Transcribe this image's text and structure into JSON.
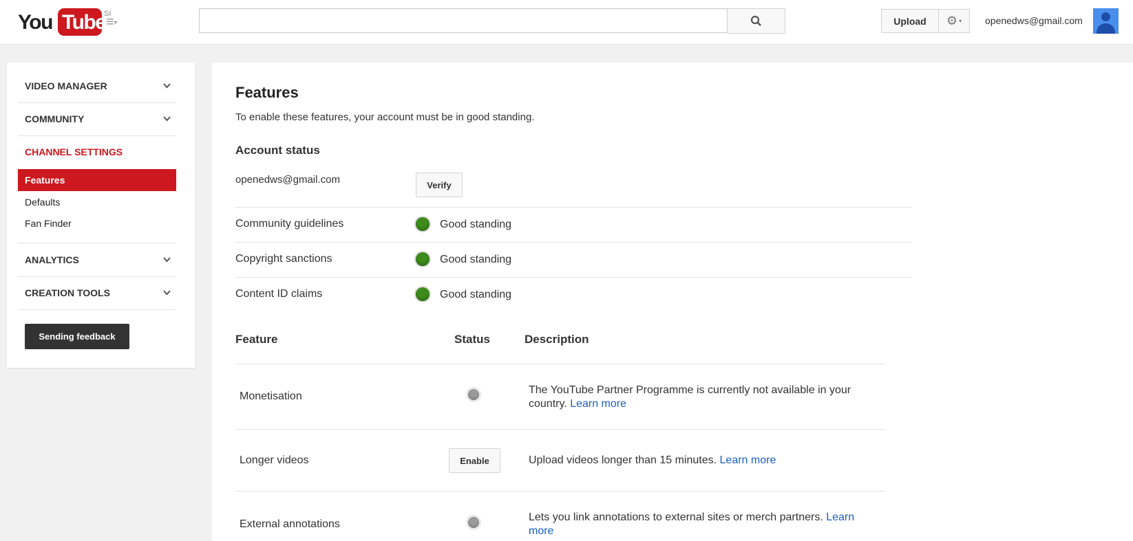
{
  "header": {
    "logo_you": "You",
    "logo_tube": "Tube",
    "country_code": "SI",
    "search_placeholder": "",
    "upload_label": "Upload",
    "account_email": "openedws@gmail.com"
  },
  "sidebar": {
    "sections": [
      {
        "label": "VIDEO MANAGER"
      },
      {
        "label": "COMMUNITY"
      },
      {
        "label": "CHANNEL SETTINGS"
      },
      {
        "label": "ANALYTICS"
      },
      {
        "label": "CREATION TOOLS"
      }
    ],
    "channel_items": [
      {
        "label": "Features",
        "active": true
      },
      {
        "label": "Defaults",
        "active": false
      },
      {
        "label": "Fan Finder",
        "active": false
      }
    ],
    "feedback_label": "Sending feedback"
  },
  "main": {
    "title": "Features",
    "subtitle": "To enable these features, your account must be in good standing.",
    "account_status_heading": "Account status",
    "account_email": "openedws@gmail.com",
    "verify_label": "Verify",
    "statuses": [
      {
        "label": "Community guidelines",
        "value": "Good standing"
      },
      {
        "label": "Copyright sanctions",
        "value": "Good standing"
      },
      {
        "label": "Content ID claims",
        "value": "Good standing"
      }
    ],
    "table_headers": {
      "feature": "Feature",
      "status": "Status",
      "description": "Description"
    },
    "features": [
      {
        "name": "Monetisation",
        "status": "unavailable",
        "description": "The YouTube Partner Programme is currently not available in your country.",
        "link": "Learn more"
      },
      {
        "name": "Longer videos",
        "status_button": "Enable",
        "description": "Upload videos longer than 15 minutes.",
        "link": "Learn more"
      },
      {
        "name": "External annotations",
        "status": "unavailable",
        "description": "Lets you link annotations to external sites or merch partners.",
        "link": "Learn more"
      }
    ]
  },
  "colors": {
    "brand_red": "#cc181e",
    "good_green": "#3d8c1b",
    "link_blue": "#1a5fc1"
  }
}
